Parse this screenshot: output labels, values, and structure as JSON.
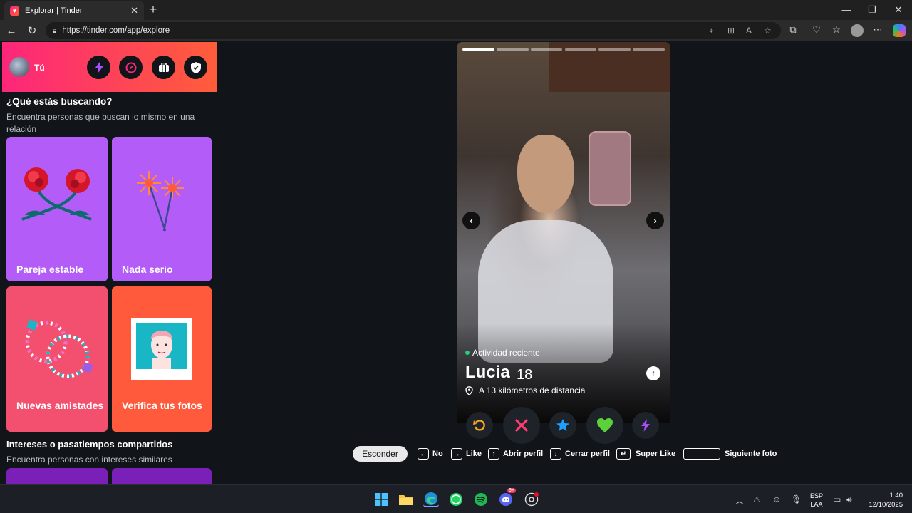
{
  "browser": {
    "tab_title": "Explorar | Tinder",
    "tab_close": "✕",
    "new_tab": "+",
    "url": "https://tinder.com/app/explore",
    "window_minimize": "—",
    "window_maximize": "❐",
    "window_close": "✕"
  },
  "sidebar": {
    "user_name": "Tú",
    "section1_title": "¿Qué estás buscando?",
    "section1_subtitle": "Encuentra personas que buscan lo mismo en una relación",
    "cards": [
      {
        "label": "Pareja estable",
        "color": "#b45cf7"
      },
      {
        "label": "Nada serio",
        "color": "#b45cf7"
      },
      {
        "label": "Nuevas amistades",
        "color": "#f2506e"
      },
      {
        "label": "Verifica tus fotos",
        "color": "#ff5a3c"
      }
    ],
    "section2_title": "Intereses o pasatiempos compartidos",
    "section2_subtitle": "Encuentra personas con intereses similares",
    "bottom_card_color": "#7a1fb8"
  },
  "profile": {
    "activity": "Actividad reciente",
    "name": "Lucia",
    "age": "18",
    "distance": "A 13 kilómetros de distancia",
    "photo_count": 6,
    "current_photo": 1
  },
  "shortcuts": {
    "hide": "Esconder",
    "no": "No",
    "like": "Like",
    "open_profile": "Abrir perfil",
    "close_profile": "Cerrar perfil",
    "super_like": "Super Like",
    "next_photo": "Siguiente foto"
  },
  "taskbar": {
    "lang_top": "ESP",
    "lang_bottom": "LAA",
    "time": "1:40",
    "date": "12/10/2025",
    "discord_badge": "9+"
  },
  "colors": {
    "brand_start": "#fd267a",
    "brand_end": "#ff5d3a",
    "rewind": "#f5a623",
    "nope": "#fe3c72",
    "superlike": "#1ea0ff",
    "like": "#5bd13a",
    "boost": "#a64dff"
  }
}
